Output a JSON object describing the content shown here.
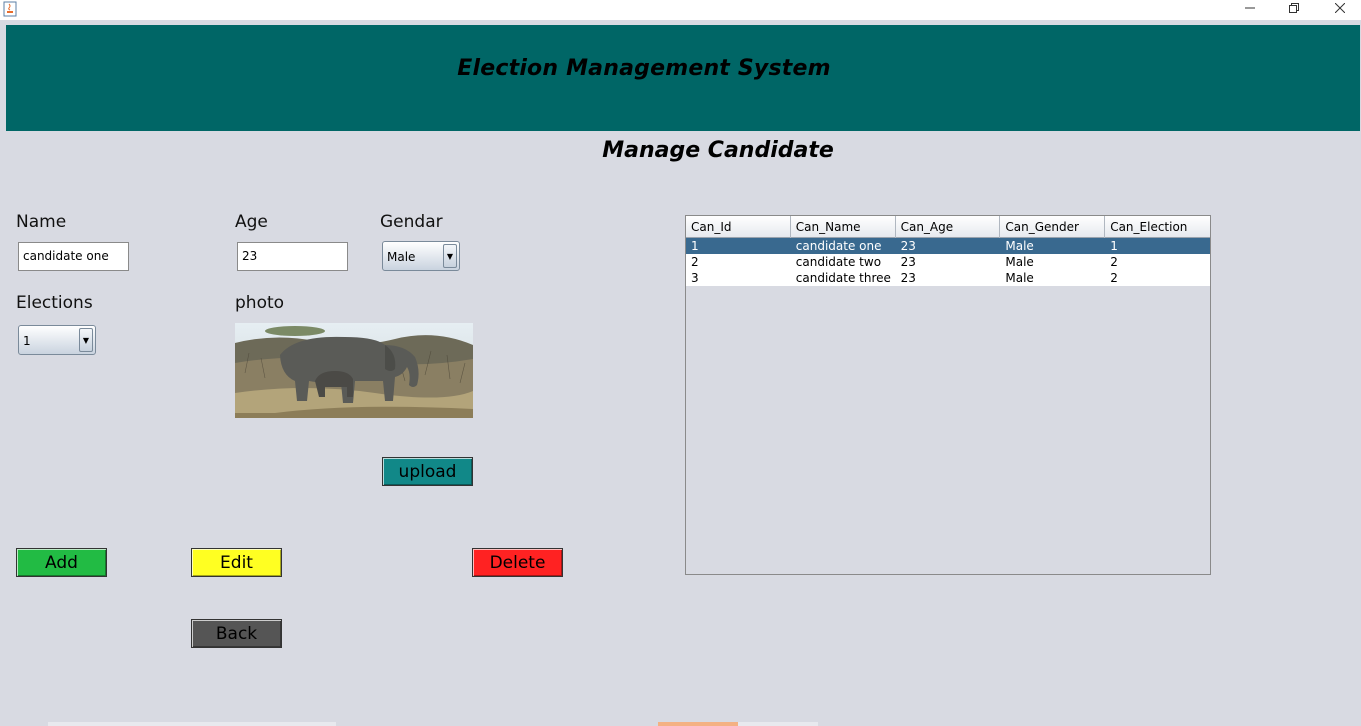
{
  "header": {
    "title": "Election Management System"
  },
  "page": {
    "title": "Manage Candidate"
  },
  "form": {
    "name_label": "Name",
    "name_value": "candidate one",
    "age_label": "Age",
    "age_value": "23",
    "gender_label": "Gendar",
    "gender_value": "Male",
    "elections_label": "Elections",
    "elections_value": "1",
    "photo_label": "photo"
  },
  "buttons": {
    "upload": "upload",
    "add": "Add",
    "edit": "Edit",
    "delete": "Delete",
    "back": "Back"
  },
  "colors": {
    "header_bg": "#006666",
    "add": "#22bb44",
    "edit": "#ffff22",
    "delete": "#ff2222",
    "back": "#555555",
    "upload": "#118888",
    "selected_row": "#39698f"
  },
  "table": {
    "columns": [
      "Can_Id",
      "Can_Name",
      "Can_Age",
      "Can_Gender",
      "Can_Election"
    ],
    "rows": [
      [
        "1",
        "candidate one",
        "23",
        "Male",
        "1"
      ],
      [
        "2",
        "candidate two",
        "23",
        "Male",
        "2"
      ],
      [
        "3",
        "candidate three",
        "23",
        "Male",
        "2"
      ]
    ],
    "selected_row": 0
  },
  "icons": {
    "app": "java-cup-icon",
    "minimize": "minimize-icon",
    "maximize": "restore-icon",
    "close": "close-icon",
    "dropdown": "chevron-down-icon"
  }
}
